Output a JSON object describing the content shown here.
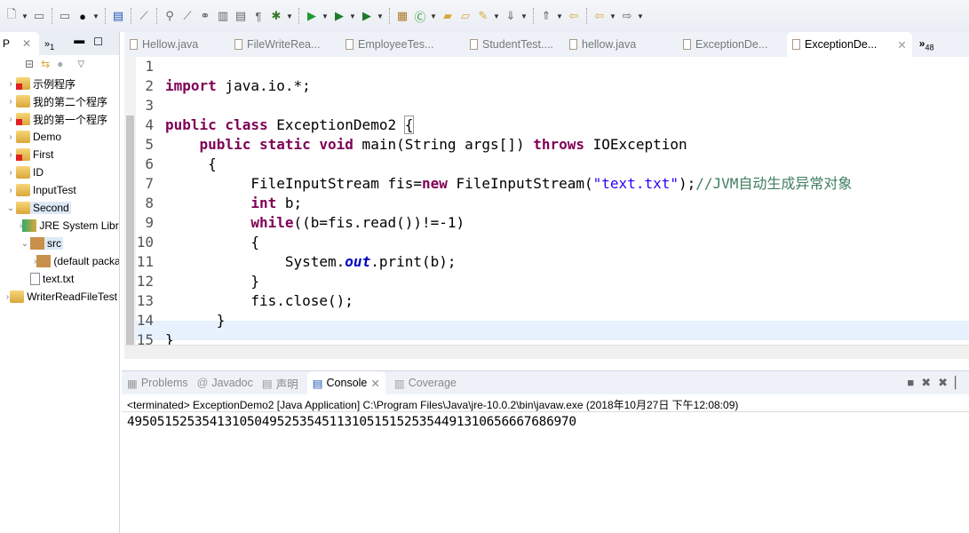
{
  "toolbar": {
    "icons": [
      "new-icon",
      "save-icon",
      "save-all-icon",
      "user-icon",
      "console-icon",
      "pin-icon",
      "annotation-icon",
      "brush-icon",
      "link-icon",
      "block-icon",
      "list-icon",
      "pilcrow-icon",
      "debug-icon",
      "run-icon",
      "run-coverage-icon",
      "external-tools-icon",
      "new-package-icon",
      "new-class-icon",
      "open-folder-icon",
      "open-type-icon",
      "pencil-icon",
      "next-annotation-icon",
      "prev-annotation-icon",
      "last-edit-icon",
      "back-icon",
      "forward-icon"
    ]
  },
  "left": {
    "tab_label": "P",
    "overflow_label": "»",
    "overflow_count": "1",
    "tree": [
      {
        "label": "示例程序",
        "error": true,
        "indent": 0,
        "arrow": "›"
      },
      {
        "label": "我的第二个程序",
        "error": false,
        "indent": 0,
        "arrow": "›"
      },
      {
        "label": "我的第一个程序",
        "error": true,
        "indent": 0,
        "arrow": "›"
      },
      {
        "label": "Demo",
        "error": false,
        "indent": 0,
        "arrow": "›"
      },
      {
        "label": "First",
        "error": true,
        "indent": 0,
        "arrow": "›"
      },
      {
        "label": "ID",
        "error": false,
        "indent": 0,
        "arrow": "›"
      },
      {
        "label": "InputTest",
        "error": false,
        "indent": 0,
        "arrow": "›"
      },
      {
        "label": "Second",
        "error": false,
        "indent": 0,
        "arrow": "⌄",
        "selected": true
      },
      {
        "label": "JRE System Library",
        "error": false,
        "indent": 1,
        "arrow": "›"
      },
      {
        "label": "src",
        "error": false,
        "indent": 1,
        "arrow": "⌄",
        "selected": true
      },
      {
        "label": "(default package)",
        "error": false,
        "indent": 2,
        "arrow": "›"
      },
      {
        "label": "text.txt",
        "error": false,
        "indent": 1,
        "arrow": ""
      },
      {
        "label": "WriterReadFileTest",
        "error": false,
        "indent": 0,
        "arrow": "›"
      }
    ]
  },
  "editor": {
    "tabs": [
      "Hellow.java",
      "FileWriteRea...",
      "EmployeeTes...",
      "StudentTest....",
      "hellow.java",
      "ExceptionDe...",
      "ExceptionDe..."
    ],
    "active_tab": 6,
    "overflow_label": "»",
    "overflow_count": "48",
    "line_numbers": [
      "1",
      "2",
      "3",
      "4",
      "5",
      "6",
      "7",
      "8",
      "9",
      "10",
      "11",
      "12",
      "13",
      "14",
      "15"
    ]
  },
  "console": {
    "tabs": [
      "Problems",
      "Javadoc",
      "声明",
      "Console",
      "Coverage"
    ],
    "active_tab": 3,
    "status": "<terminated> ExceptionDemo2 [Java Application] C:\\Program Files\\Java\\jre-10.0.2\\bin\\javaw.exe (2018年10月27日 下午12:08:09)",
    "output": "4950515253541310504952535451131051515253544913106566676869 70"
  }
}
